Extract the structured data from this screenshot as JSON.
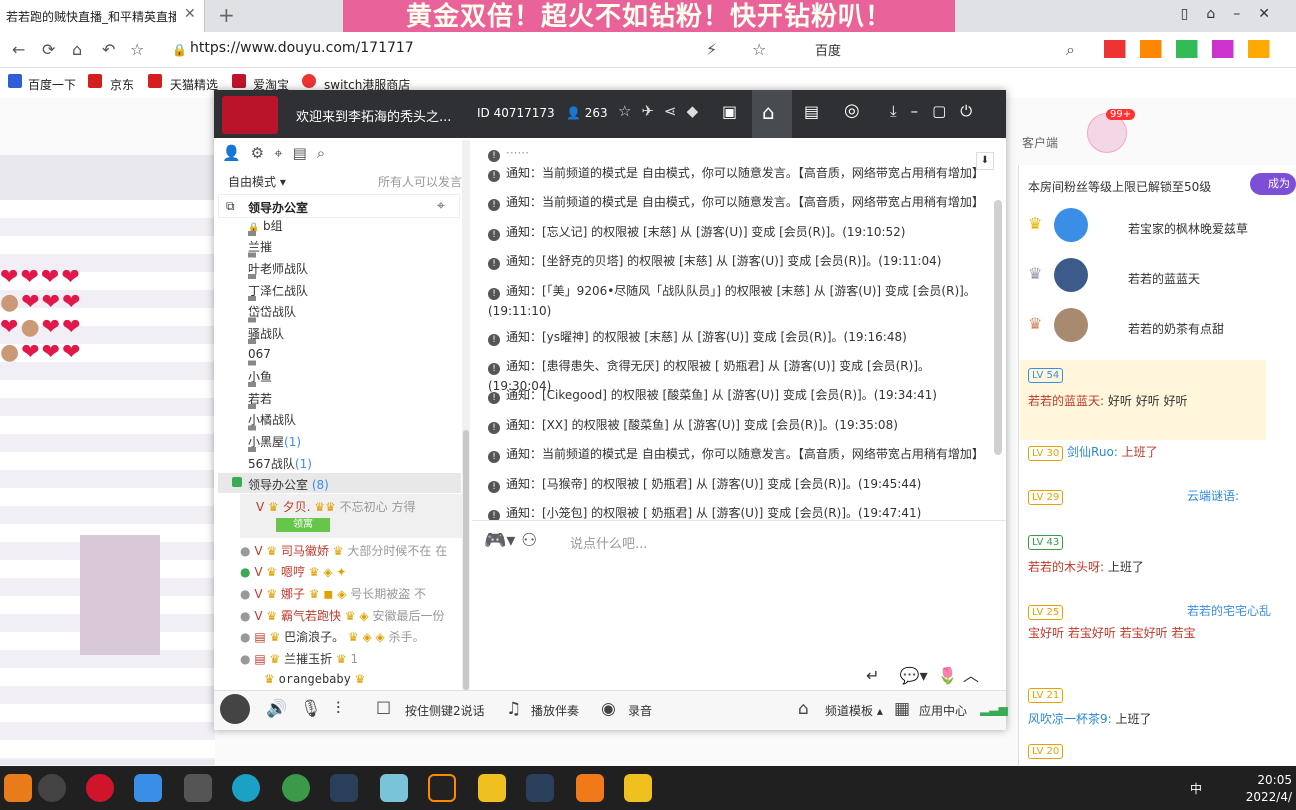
{
  "browser": {
    "tab_title": "若若跑的贼快直播_和平精英直播",
    "url": "https://www.douyu.com/171717",
    "search_engine": "百度",
    "bookmarks": [
      "百度一下",
      "京东",
      "天猫精选",
      "爱淘宝",
      "switch港服商店"
    ]
  },
  "ad_banner": "黄金双倍！超火不如钻粉！快开钻粉叭！",
  "app": {
    "room_title": "欢迎来到李拓海的秃头之...",
    "room_id": "40717173",
    "online_count": "263",
    "mode": "自由模式",
    "can_speak": "所有人可以发言",
    "channel": "领导办公室",
    "sub_channels": [
      {
        "name": "b组",
        "count": ""
      },
      {
        "name": "兰摧",
        "count": ""
      },
      {
        "name": "叶老师战队",
        "count": ""
      },
      {
        "name": "丁泽仁战队",
        "count": ""
      },
      {
        "name": "岱岱战队",
        "count": ""
      },
      {
        "name": "骚战队",
        "count": ""
      },
      {
        "name": "067",
        "count": ""
      },
      {
        "name": "小鱼",
        "count": ""
      },
      {
        "name": "若若",
        "count": ""
      },
      {
        "name": "小橘战队",
        "count": ""
      },
      {
        "name": "小黑屋",
        "count": "(1)"
      },
      {
        "name": "567战队",
        "count": "(1)"
      }
    ],
    "selected_channel": "领导办公室",
    "selected_count": "(8)",
    "members": [
      {
        "name": "夕贝.",
        "note": "不忘初心 方得"
      },
      {
        "name": "司马徽娇",
        "note": "大部分时候不在 在"
      },
      {
        "name": "嗯哼",
        "note": ""
      },
      {
        "name": "娜子",
        "note": "号长期被盗 不"
      },
      {
        "name": "霸气若跑快",
        "note": "安徽最后一份"
      },
      {
        "name": "巴渝浪子。",
        "note": "杀手。"
      },
      {
        "name": "兰摧玉折",
        "note": "1"
      },
      {
        "name": "orangebaby",
        "note": ""
      }
    ],
    "leader_tag": "领寓",
    "notices": [
      "通知：当前频道的模式是 自由模式，你可以随意发言。【高音质，网络带宽占用稍有增加】",
      "通知：当前频道的模式是 自由模式，你可以随意发言。【高音质，网络带宽占用稍有增加】",
      "通知：[忘乂记] 的权限被 [末慈] 从 [游客(U)] 变成 [会员(R)]。(19:10:52)",
      "通知：[坐舒克的贝塔] 的权限被 [末慈] 从 [游客(U)] 变成 [会员(R)]。(19:11:04)",
      "通知：[「美」9206•尽随风「战队队员」] 的权限被 [末慈] 从 [游客(U)] 变成 [会员(R)]。(19:11:10)",
      "通知：[ys曜神] 的权限被 [末慈] 从 [游客(U)] 变成 [会员(R)]。(19:16:48)",
      "通知：[患得患失、贪得无厌] 的权限被 [ 奶瓶君] 从 [游客(U)] 变成 [会员(R)]。(19:30:04)",
      "通知：[Cikegood] 的权限被 [酸菜鱼] 从 [游客(U)] 变成 [会员(R)]。(19:34:41)",
      "通知：[XX] 的权限被 [酸菜鱼] 从 [游客(U)] 变成 [会员(R)]。(19:35:08)",
      "通知：当前频道的模式是 自由模式，你可以随意发言。【高音质，网络带宽占用稍有增加】",
      "通知：[马猴帝] 的权限被 [ 奶瓶君] 从 [游客(U)] 变成 [会员(R)]。(19:45:44)",
      "通知：[小笼包] 的权限被 [ 奶瓶君] 从 [游客(U)] 变成 [会员(R)]。(19:47:41)"
    ],
    "input_placeholder": "说点什么吧...",
    "footer": {
      "push_to_talk": "按住侧键2说话",
      "accompany": "播放伴奏",
      "record": "录音",
      "channel_template": "频道模板",
      "app_center": "应用中心"
    }
  },
  "right_pane": {
    "fan_limit": "本房间粉丝等级上限已解锁至50级",
    "fan_badge": "成为",
    "client": "客户端",
    "badge_count": "99+",
    "ranks": [
      {
        "name": "若宝家的枫林晚爱兹草"
      },
      {
        "name": "若若的蓝蓝天"
      },
      {
        "name": "若若的奶茶有点甜"
      }
    ],
    "messages": [
      {
        "lv": "LV 54",
        "user": "若若的蓝蓝天:",
        "text": "好听 好听 好听"
      },
      {
        "lv": "LV 30",
        "user": "剑仙Ruo:",
        "text": "上班了"
      },
      {
        "lv": "LV 29",
        "user": "云端谜语:",
        "text": ""
      },
      {
        "lv": "LV 43",
        "user": "若若的木头呀:",
        "text": "上班了"
      },
      {
        "lv": "LV 25",
        "user": "若若的宅宅心乱",
        "text": "宝好听 若宝好听 若宝好听 若宝"
      },
      {
        "lv": "LV 21",
        "user": "风吹凉一杯茶9:",
        "text": "上班了"
      },
      {
        "lv": "LV 20",
        "user": "",
        "text": ""
      }
    ]
  },
  "taskbar": {
    "time": "20:05",
    "date": "2022/4/",
    "ime": "中"
  },
  "colors": {
    "accent": "#3a8ee6",
    "header": "#2e3033",
    "ad": "#e9629a"
  }
}
